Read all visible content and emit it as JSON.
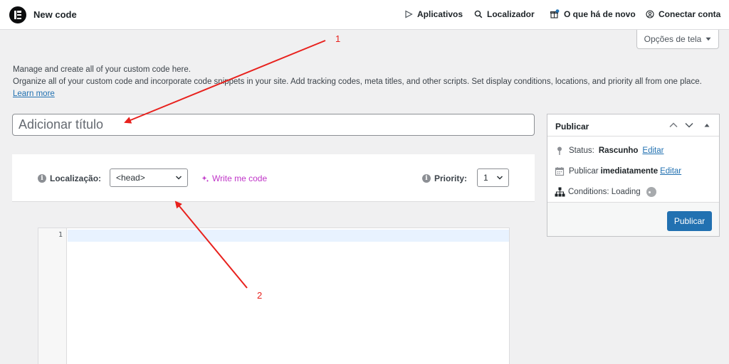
{
  "header": {
    "title": "New code",
    "nav": [
      {
        "label": "Aplicativos",
        "icon": "play-outline-icon"
      },
      {
        "label": "Localizador",
        "icon": "search-icon"
      },
      {
        "label": "O que há de novo",
        "icon": "gift-icon"
      },
      {
        "label": "Conectar conta",
        "icon": "user-circle-icon"
      }
    ]
  },
  "screen_options": {
    "label": "Opções de tela"
  },
  "intro": {
    "line1": "Manage and create all of your custom code here.",
    "line2": "Organize all of your custom code and incorporate code snippets in your site. Add tracking codes, meta titles, and other scripts. Set display conditions, locations, and priority all from one place.",
    "link": "Learn more"
  },
  "title_field": {
    "placeholder": "Adicionar título",
    "value": ""
  },
  "code_settings": {
    "location_label": "Localização:",
    "location_value": "<head>",
    "write_code_label": "Write me code",
    "priority_label": "Priority:",
    "priority_value": "1"
  },
  "editor": {
    "line_numbers": [
      "1"
    ]
  },
  "publish": {
    "title": "Publicar",
    "status_label": "Status:",
    "status_value": "Rascunho",
    "status_edit": "Editar",
    "schedule_label": "Publicar",
    "schedule_value": "imediatamente",
    "schedule_edit": "Editar",
    "conditions_label": "Conditions: Loading",
    "button": "Publicar"
  },
  "annotations": [
    "1",
    "2"
  ],
  "colors": {
    "accent": "#2271b1",
    "annotation": "#e8211d",
    "ai_link": "#c036c8"
  }
}
